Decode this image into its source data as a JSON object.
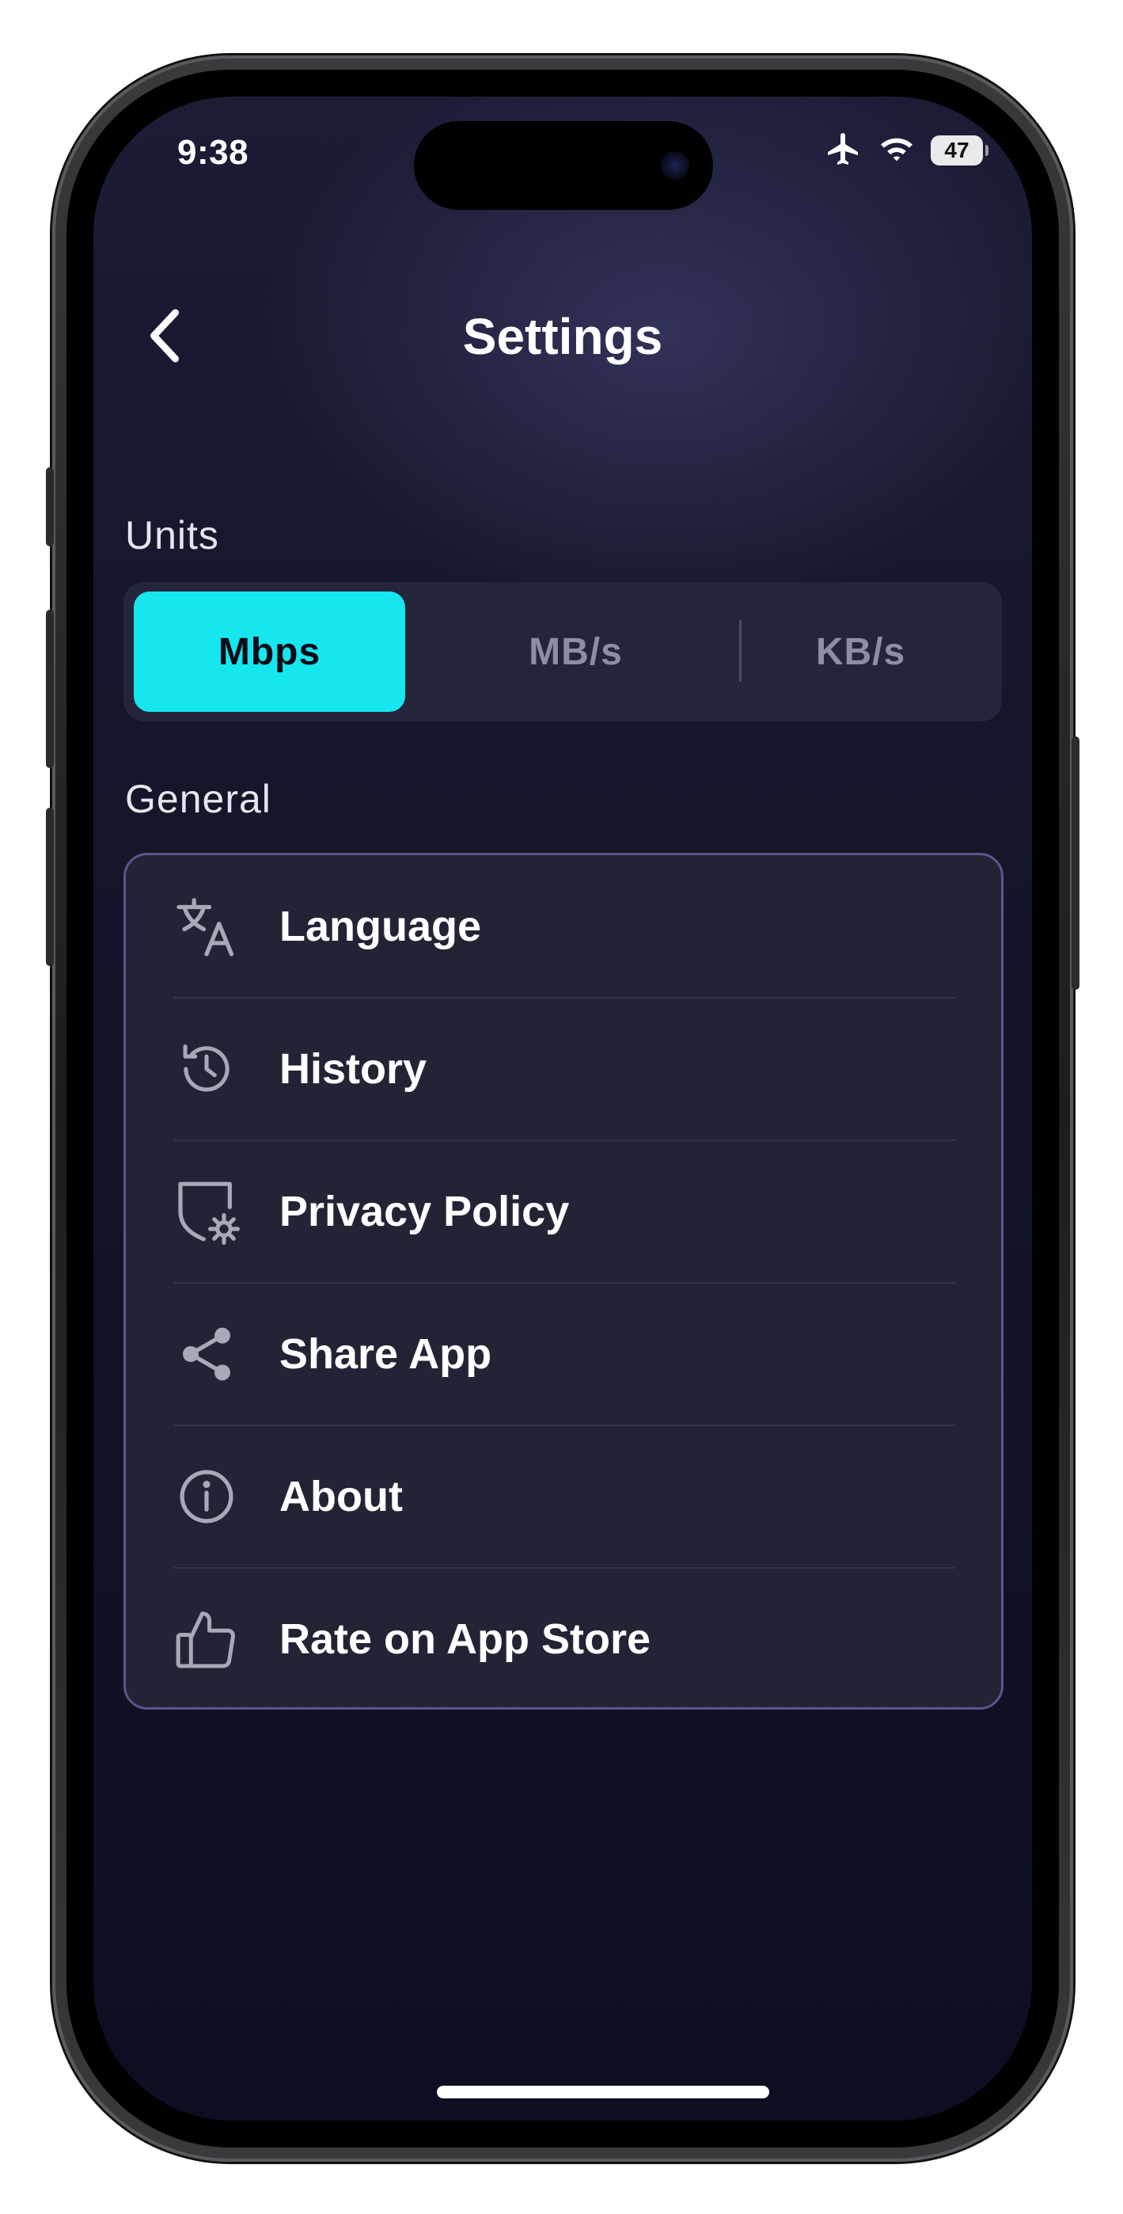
{
  "status_bar": {
    "time": "9:38",
    "battery": "47",
    "icons": [
      "airplane-icon",
      "wifi-icon",
      "battery-icon"
    ]
  },
  "header": {
    "title": "Settings",
    "back_icon": "chevron-left-icon"
  },
  "units": {
    "section_label": "Units",
    "options": [
      "Mbps",
      "MB/s",
      "KB/s"
    ],
    "selected": "Mbps"
  },
  "general": {
    "section_label": "General",
    "items": [
      {
        "label": "Language",
        "icon": "translate-icon"
      },
      {
        "label": "History",
        "icon": "history-icon"
      },
      {
        "label": "Privacy Policy",
        "icon": "shield-gear-icon"
      },
      {
        "label": "Share App",
        "icon": "share-icon"
      },
      {
        "label": "About",
        "icon": "info-icon"
      },
      {
        "label": "Rate on App Store",
        "icon": "thumbs-up-icon"
      }
    ]
  },
  "colors": {
    "accent": "#16e6ee",
    "card_border": "#57578f",
    "background": "#121327"
  }
}
